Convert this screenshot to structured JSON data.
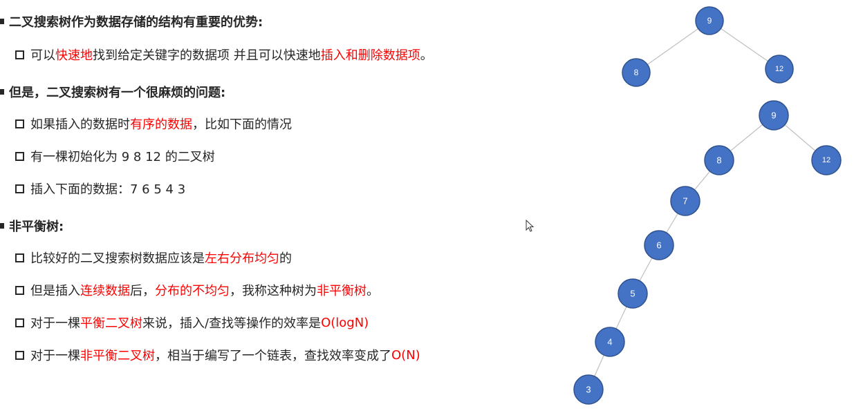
{
  "section1": {
    "heading": "二叉搜索树作为数据存储的结构有重要的优势:",
    "item1": [
      "可以",
      "快速地",
      "找到给定关键字的数据项 并且可以快速地",
      "插入和删除数据项",
      "。"
    ]
  },
  "section2": {
    "heading": "但是，二叉搜索树有一个很麻烦的问题:",
    "item1": [
      "如果插入的数据时",
      "有序的数据",
      "，比如下面的情况"
    ],
    "item2": "有一棵初始化为 9 8 12 的二叉树",
    "item3": "插入下面的数据：7 6 5 4 3"
  },
  "section3": {
    "heading": "非平衡树:",
    "item1": [
      "比较好的二叉搜索树数据应该是",
      "左右分布均匀",
      "的"
    ],
    "item2": [
      "但是插入",
      "连续数据",
      "后，",
      "分布的不均匀",
      "，我称这种树为",
      "非平衡树",
      "。"
    ],
    "item3": [
      "对于一棵",
      "平衡二叉树",
      "来说，插入/查找等操作的效率是",
      "O(logN)"
    ],
    "item4": [
      "对于一棵",
      "非平衡二叉树",
      "，相当于编写了一个链表，查找效率变成了",
      "O(N)"
    ]
  },
  "colors": {
    "highlight": "#ff0000",
    "node_fill": "#4472c4",
    "edge": "#bfbfbf"
  },
  "tree_small": {
    "root": "9",
    "left": "8",
    "right": "12"
  },
  "tree_large": {
    "nodes": [
      "9",
      "8",
      "12",
      "7",
      "6",
      "5",
      "4",
      "3"
    ]
  }
}
